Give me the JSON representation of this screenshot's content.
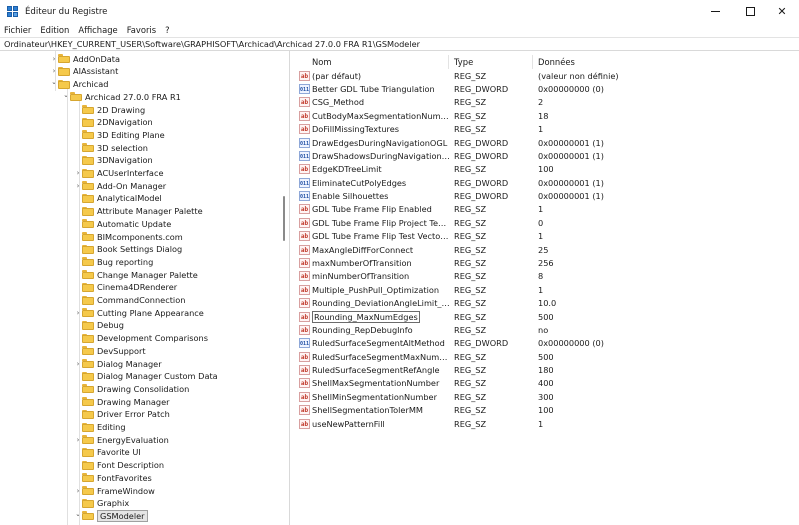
{
  "window": {
    "title": "Éditeur du Registre",
    "icon": "registry-editor-icon",
    "controls": {
      "minimize": "minimize-icon",
      "maximize": "maximize-icon",
      "close": "✕"
    }
  },
  "menu": [
    "Fichier",
    "Edition",
    "Affichage",
    "Favoris",
    "?"
  ],
  "address": "Ordinateur\\HKEY_CURRENT_USER\\Software\\GRAPHISOFT\\Archicad\\Archicad 27.0.0 FRA R1\\GSModeler",
  "tree": [
    {
      "label": "AddOnData",
      "expander": "collapsed"
    },
    {
      "label": "AIAssistant",
      "expander": "collapsed"
    },
    {
      "label": "Archicad",
      "expander": "expanded"
    },
    {
      "label": "Archicad 27.0.0 FRA R1",
      "expander": "expanded"
    },
    {
      "label": "2D Drawing",
      "expander": ""
    },
    {
      "label": "2DNavigation",
      "expander": ""
    },
    {
      "label": "3D Editing Plane",
      "expander": ""
    },
    {
      "label": "3D selection",
      "expander": ""
    },
    {
      "label": "3DNavigation",
      "expander": ""
    },
    {
      "label": "ACUserInterface",
      "expander": "collapsed"
    },
    {
      "label": "Add-On Manager",
      "expander": "collapsed"
    },
    {
      "label": "AnalyticalModel",
      "expander": ""
    },
    {
      "label": "Attribute Manager Palette",
      "expander": ""
    },
    {
      "label": "Automatic Update",
      "expander": ""
    },
    {
      "label": "BIMcomponents.com",
      "expander": ""
    },
    {
      "label": "Book Settings Dialog",
      "expander": ""
    },
    {
      "label": "Bug reporting",
      "expander": ""
    },
    {
      "label": "Change Manager Palette",
      "expander": ""
    },
    {
      "label": "Cinema4DRenderer",
      "expander": ""
    },
    {
      "label": "CommandConnection",
      "expander": ""
    },
    {
      "label": "Cutting Plane Appearance",
      "expander": "collapsed"
    },
    {
      "label": "Debug",
      "expander": ""
    },
    {
      "label": "Development Comparisons",
      "expander": ""
    },
    {
      "label": "DevSupport",
      "expander": ""
    },
    {
      "label": "Dialog Manager",
      "expander": "collapsed"
    },
    {
      "label": "Dialog Manager Custom Data",
      "expander": ""
    },
    {
      "label": "Drawing Consolidation",
      "expander": ""
    },
    {
      "label": "Drawing Manager",
      "expander": ""
    },
    {
      "label": "Driver Error Patch",
      "expander": ""
    },
    {
      "label": "Editing",
      "expander": ""
    },
    {
      "label": "EnergyEvaluation",
      "expander": "collapsed"
    },
    {
      "label": "Favorite UI",
      "expander": ""
    },
    {
      "label": "Font Description",
      "expander": ""
    },
    {
      "label": "FontFavorites",
      "expander": ""
    },
    {
      "label": "FrameWindow",
      "expander": "collapsed"
    },
    {
      "label": "Graphix",
      "expander": ""
    },
    {
      "label": "GSModeler",
      "expander": "expanded",
      "selected": true
    }
  ],
  "columns": {
    "name": "Nom",
    "type": "Type",
    "data": "Données"
  },
  "values": [
    {
      "icon": "string-value-icon",
      "name": "(par défaut)",
      "type": "REG_SZ",
      "data": "(valeur non définie)"
    },
    {
      "icon": "dword-value-icon",
      "name": "Better GDL Tube Triangulation",
      "type": "REG_DWORD",
      "data": "0x00000000 (0)"
    },
    {
      "icon": "string-value-icon",
      "name": "CSG_Method",
      "type": "REG_SZ",
      "data": "2"
    },
    {
      "icon": "string-value-icon",
      "name": "CutBodyMaxSegmentationNumber",
      "type": "REG_SZ",
      "data": "18"
    },
    {
      "icon": "string-value-icon",
      "name": "DoFillMissingTextures",
      "type": "REG_SZ",
      "data": "1"
    },
    {
      "icon": "dword-value-icon",
      "name": "DrawEdgesDuringNavigationOGL",
      "type": "REG_DWORD",
      "data": "0x00000001 (1)"
    },
    {
      "icon": "dword-value-icon",
      "name": "DrawShadowsDuringNavigationOGL",
      "type": "REG_DWORD",
      "data": "0x00000001 (1)"
    },
    {
      "icon": "string-value-icon",
      "name": "EdgeKDTreeLimit",
      "type": "REG_SZ",
      "data": "100"
    },
    {
      "icon": "dword-value-icon",
      "name": "EliminateCutPolyEdges",
      "type": "REG_DWORD",
      "data": "0x00000001 (1)"
    },
    {
      "icon": "dword-value-icon",
      "name": "Enable Silhouettes",
      "type": "REG_DWORD",
      "data": "0x00000001 (1)"
    },
    {
      "icon": "string-value-icon",
      "name": "GDL Tube Frame Flip Enabled",
      "type": "REG_SZ",
      "data": "1"
    },
    {
      "icon": "string-value-icon",
      "name": "GDL Tube Frame Flip Project Test V...",
      "type": "REG_SZ",
      "data": "0"
    },
    {
      "icon": "string-value-icon",
      "name": "GDL Tube Frame Flip Test Vector Se...",
      "type": "REG_SZ",
      "data": "1"
    },
    {
      "icon": "string-value-icon",
      "name": "MaxAngleDiffForConnect",
      "type": "REG_SZ",
      "data": "25"
    },
    {
      "icon": "string-value-icon",
      "name": "maxNumberOfTransition",
      "type": "REG_SZ",
      "data": "256"
    },
    {
      "icon": "string-value-icon",
      "name": "minNumberOfTransition",
      "type": "REG_SZ",
      "data": "8"
    },
    {
      "icon": "string-value-icon",
      "name": "Multiple_PushPull_Optimization",
      "type": "REG_SZ",
      "data": "1"
    },
    {
      "icon": "string-value-icon",
      "name": "Rounding_DeviationAngleLimit_de...",
      "type": "REG_SZ",
      "data": "10.0"
    },
    {
      "icon": "string-value-icon",
      "name": "Rounding_MaxNumEdges",
      "type": "REG_SZ",
      "data": "500",
      "focused": true
    },
    {
      "icon": "string-value-icon",
      "name": "Rounding_RepDebugInfo",
      "type": "REG_SZ",
      "data": "no"
    },
    {
      "icon": "dword-value-icon",
      "name": "RuledSurfaceSegmentAltMethod",
      "type": "REG_DWORD",
      "data": "0x00000000 (0)"
    },
    {
      "icon": "string-value-icon",
      "name": "RuledSurfaceSegmentMaxNumber",
      "type": "REG_SZ",
      "data": "500"
    },
    {
      "icon": "string-value-icon",
      "name": "RuledSurfaceSegmentRefAngle",
      "type": "REG_SZ",
      "data": "180"
    },
    {
      "icon": "string-value-icon",
      "name": "ShellMaxSegmentationNumber",
      "type": "REG_SZ",
      "data": "400"
    },
    {
      "icon": "string-value-icon",
      "name": "ShellMinSegmentationNumber",
      "type": "REG_SZ",
      "data": "300"
    },
    {
      "icon": "string-value-icon",
      "name": "ShellSegmentationTolerMM",
      "type": "REG_SZ",
      "data": "100"
    },
    {
      "icon": "string-value-icon",
      "name": "useNewPatternFill",
      "type": "REG_SZ",
      "data": "1"
    }
  ]
}
